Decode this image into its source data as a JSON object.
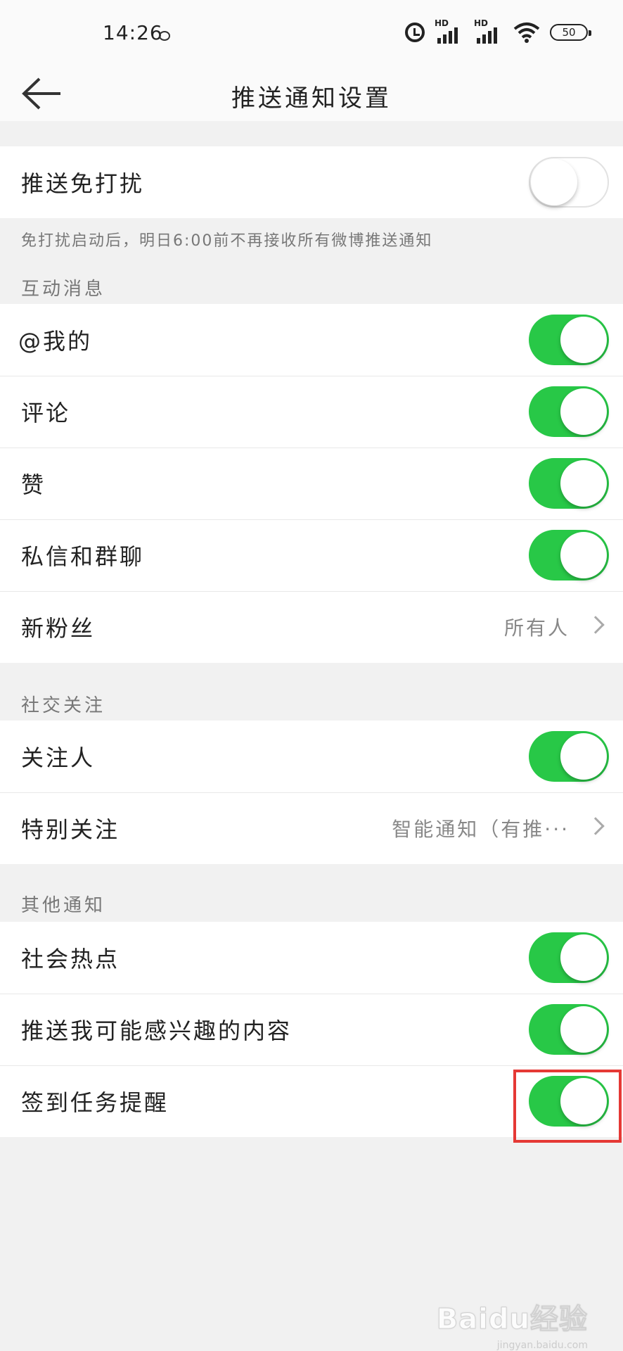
{
  "status_bar": {
    "time": "14:26",
    "battery": "50",
    "network_label": "HD"
  },
  "nav": {
    "title": "推送通知设置"
  },
  "dnd": {
    "label": "推送免打扰",
    "enabled": false,
    "note": "免打扰启动后，明日6:00前不再接收所有微博推送通知"
  },
  "interaction": {
    "header": "互动消息",
    "rows": [
      {
        "label": "@我的",
        "enabled": true
      },
      {
        "label": "评论",
        "enabled": true
      },
      {
        "label": "赞",
        "enabled": true
      },
      {
        "label": "私信和群聊",
        "enabled": true
      },
      {
        "label": "新粉丝",
        "value": "所有人"
      }
    ]
  },
  "social": {
    "header": "社交关注",
    "rows": [
      {
        "label": "关注人",
        "enabled": true
      },
      {
        "label": "特别关注",
        "value": "智能通知（有推···"
      }
    ]
  },
  "other": {
    "header": "其他通知",
    "rows": [
      {
        "label": "社会热点",
        "enabled": true
      },
      {
        "label": "推送我可能感兴趣的内容",
        "enabled": true
      },
      {
        "label": "签到任务提醒",
        "enabled": true
      }
    ]
  },
  "colors": {
    "toggle_on": "#28c847",
    "highlight": "#e53935"
  },
  "watermark": {
    "text": "Baidu经验",
    "sub": "jingyan.baidu.com"
  }
}
